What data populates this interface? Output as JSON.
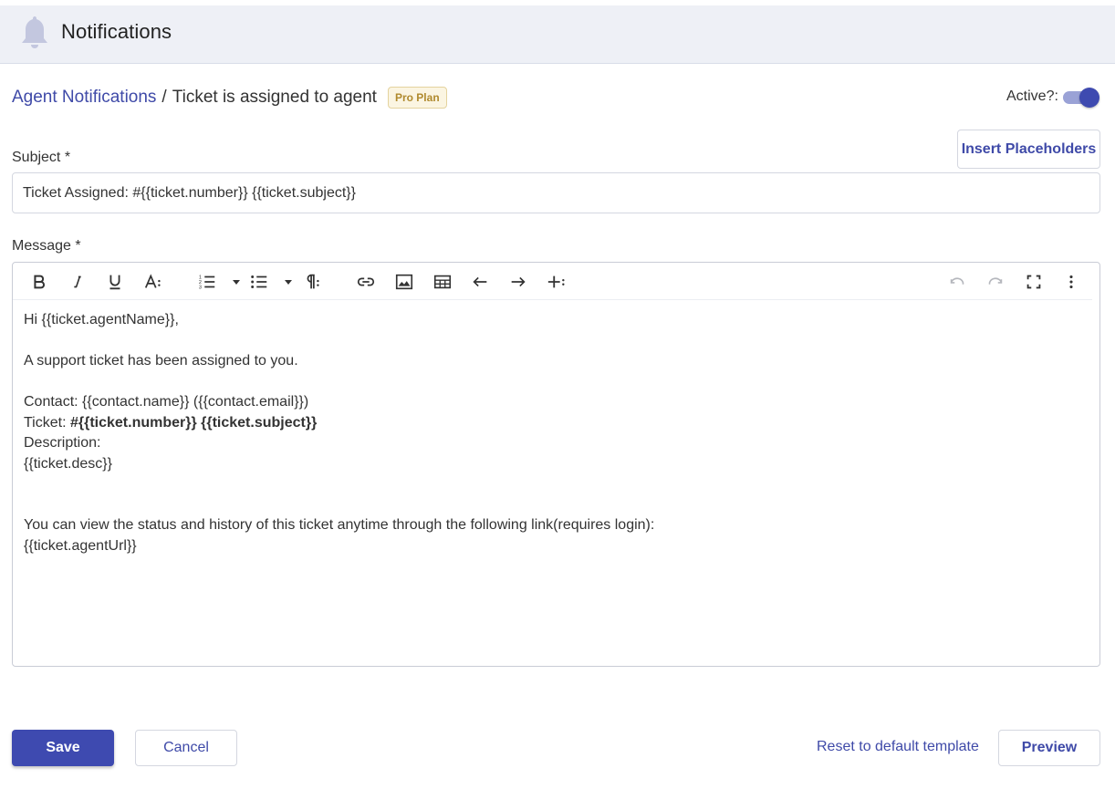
{
  "header": {
    "title": "Notifications",
    "icon": "bell-icon"
  },
  "breadcrumb": {
    "parent": "Agent Notifications",
    "separator": "/",
    "current": "Ticket is assigned to agent",
    "badge": "Pro Plan"
  },
  "active": {
    "label": "Active?:",
    "value": true
  },
  "subject": {
    "label": "Subject *",
    "value": "Ticket Assigned: #{{ticket.number}} {{ticket.subject}}"
  },
  "insert_placeholders": "Insert Placeholders",
  "message": {
    "label": "Message *",
    "toolbar": [
      "bold-icon",
      "italic-icon",
      "underline-icon",
      "font-size-icon",
      "ordered-list-icon",
      "unordered-list-icon",
      "paragraph-format-icon",
      "link-icon",
      "image-icon",
      "table-icon",
      "outdent-icon",
      "indent-icon",
      "insert-more-icon",
      "undo-icon",
      "redo-icon",
      "fullscreen-icon",
      "more-vertical-icon"
    ],
    "body": {
      "greeting": "Hi {{ticket.agentName}},",
      "intro": "A support ticket has been assigned to you.",
      "contact_label": "Contact: ",
      "contact_value": "{{contact.name}} ({{contact.email}})",
      "ticket_label": "Ticket: ",
      "ticket_value": "#{{ticket.number}} {{ticket.subject}}",
      "description_label": "Description:",
      "description_value": "{{ticket.desc}}",
      "view_text": "You can view the status and history of this ticket anytime through the following link(requires login):",
      "agent_url": "{{ticket.agentUrl}}"
    }
  },
  "actions": {
    "save": "Save",
    "cancel": "Cancel",
    "reset": "Reset to default template",
    "preview": "Preview"
  },
  "colors": {
    "accent": "#3e4ab0",
    "badge_text": "#b08a2e",
    "header_bg": "#eef0f6"
  }
}
